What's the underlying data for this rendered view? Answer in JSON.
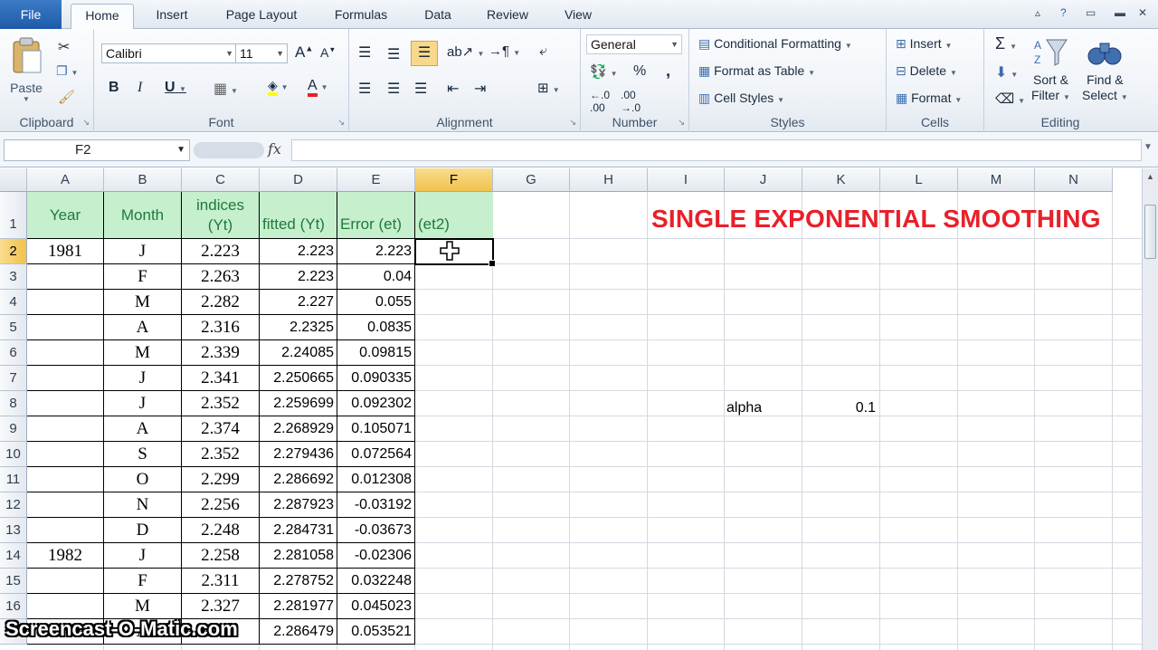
{
  "ribbon_tabs": {
    "file": "File",
    "items": [
      "Home",
      "Insert",
      "Page Layout",
      "Formulas",
      "Data",
      "Review",
      "View"
    ],
    "active": "Home"
  },
  "clipboard": {
    "paste": "Paste",
    "label": "Clipboard"
  },
  "font": {
    "name": "Calibri",
    "size": "11",
    "label": "Font",
    "bold": "B",
    "italic": "I",
    "underline": "U",
    "grow": "A",
    "shrink": "A"
  },
  "alignment": {
    "label": "Alignment"
  },
  "number": {
    "format": "General",
    "label": "Number",
    "percent": "%",
    "comma": ","
  },
  "styles": {
    "conditional": "Conditional Formatting",
    "table": "Format as Table",
    "cell_styles": "Cell Styles",
    "label": "Styles"
  },
  "cells": {
    "insert": "Insert",
    "delete": "Delete",
    "format": "Format",
    "label": "Cells"
  },
  "editing": {
    "sigma": "Σ",
    "sort_line1": "Sort &",
    "sort_line2": "Filter",
    "find_line1": "Find &",
    "find_line2": "Select",
    "label": "Editing"
  },
  "formula_bar": {
    "name_box": "F2",
    "fx": "fx",
    "content": ""
  },
  "columns": [
    "A",
    "B",
    "C",
    "D",
    "E",
    "F",
    "G",
    "H",
    "I",
    "J",
    "K",
    "L",
    "M",
    "N"
  ],
  "selected_column": "F",
  "rows": [
    "1",
    "2",
    "3",
    "4",
    "5",
    "6",
    "7",
    "8",
    "9",
    "10",
    "11",
    "12",
    "13",
    "14",
    "15",
    "16",
    "17"
  ],
  "selected_row": "2",
  "headers": {
    "year": "Year",
    "month": "Month",
    "indices_1": "indices",
    "indices_2": "(Yt)",
    "fitted": "fitted (Yt)",
    "error": "Error (et)",
    "et2": "(et2)"
  },
  "table_rows": [
    {
      "year": "1981",
      "month": "J",
      "yt": "2.223",
      "fitted": "2.223",
      "error": "2.223"
    },
    {
      "year": "",
      "month": "F",
      "yt": "2.263",
      "fitted": "2.223",
      "error": "0.04"
    },
    {
      "year": "",
      "month": "M",
      "yt": "2.282",
      "fitted": "2.227",
      "error": "0.055"
    },
    {
      "year": "",
      "month": "A",
      "yt": "2.316",
      "fitted": "2.2325",
      "error": "0.0835"
    },
    {
      "year": "",
      "month": "M",
      "yt": "2.339",
      "fitted": "2.24085",
      "error": "0.09815"
    },
    {
      "year": "",
      "month": "J",
      "yt": "2.341",
      "fitted": "2.250665",
      "error": "0.090335"
    },
    {
      "year": "",
      "month": "J",
      "yt": "2.352",
      "fitted": "2.259699",
      "error": "0.092302"
    },
    {
      "year": "",
      "month": "A",
      "yt": "2.374",
      "fitted": "2.268929",
      "error": "0.105071"
    },
    {
      "year": "",
      "month": "S",
      "yt": "2.352",
      "fitted": "2.279436",
      "error": "0.072564"
    },
    {
      "year": "",
      "month": "O",
      "yt": "2.299",
      "fitted": "2.286692",
      "error": "0.012308"
    },
    {
      "year": "",
      "month": "N",
      "yt": "2.256",
      "fitted": "2.287923",
      "error": "-0.03192"
    },
    {
      "year": "",
      "month": "D",
      "yt": "2.248",
      "fitted": "2.284731",
      "error": "-0.03673"
    },
    {
      "year": "1982",
      "month": "J",
      "yt": "2.258",
      "fitted": "2.281058",
      "error": "-0.02306"
    },
    {
      "year": "",
      "month": "F",
      "yt": "2.311",
      "fitted": "2.278752",
      "error": "0.032248"
    },
    {
      "year": "",
      "month": "M",
      "yt": "2.327",
      "fitted": "2.281977",
      "error": "0.045023"
    },
    {
      "year": "",
      "month": "A",
      "yt": "2.35",
      "fitted": "2.286479",
      "error": "0.053521"
    }
  ],
  "title": "SINGLE EXPONENTIAL SMOOTHING",
  "alpha_label": "alpha",
  "alpha_value": "0.1",
  "watermark": "Screencast-O-Matic.com",
  "colors": {
    "title_red": "#e8202a",
    "header_green_bg": "#c6efce",
    "header_green_text": "#1f7a3a",
    "selection_orange": "#f1c24c",
    "file_tab_blue": "#2b6cb8"
  }
}
